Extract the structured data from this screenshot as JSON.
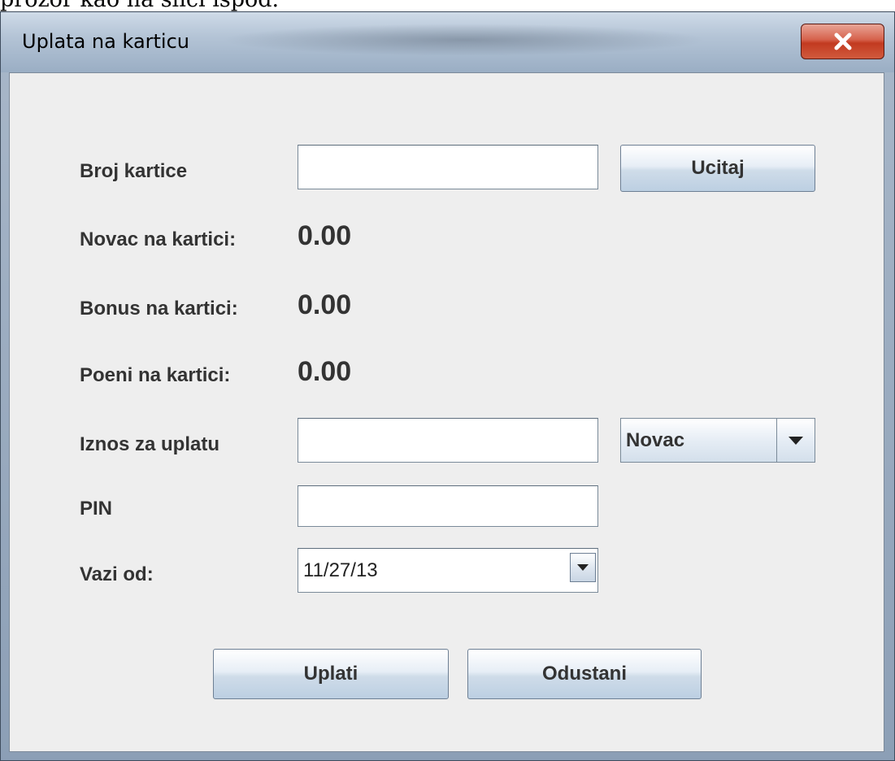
{
  "caption": "prozor kao na slici ispod.",
  "window": {
    "title": "Uplata na karticu"
  },
  "form": {
    "card_number_label": "Broj kartice",
    "card_number_value": "",
    "load_button": "Ucitaj",
    "money_label": "Novac na kartici:",
    "money_value": "0.00",
    "bonus_label": "Bonus na kartici:",
    "bonus_value": "0.00",
    "points_label": "Poeni na kartici:",
    "points_value": "0.00",
    "amount_label": "Iznos za uplatu",
    "amount_value": "",
    "amount_type_selected": "Novac",
    "pin_label": "PIN",
    "pin_value": "",
    "valid_from_label": "Vazi od:",
    "valid_from_value": "11/27/13"
  },
  "actions": {
    "pay_button": "Uplati",
    "cancel_button": "Odustani"
  },
  "icons": {
    "close": "close-icon",
    "dropdown": "chevron-down-icon"
  },
  "colors": {
    "client_bg": "#eeeeee",
    "close_button": "#c23a20",
    "label_text": "#333333"
  }
}
